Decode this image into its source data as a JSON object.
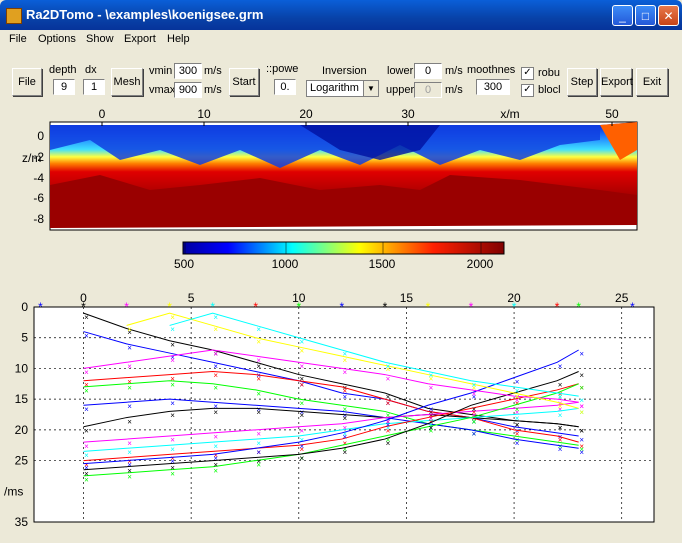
{
  "window": {
    "title": "Ra2DTomo - \\examples\\koenigsee.grm"
  },
  "menu": [
    "File",
    "Options",
    "Show",
    "Export",
    "Help"
  ],
  "toolbar": {
    "file_btn": "File",
    "depth_label": "depth",
    "depth_value": "9",
    "dx_label": "dx",
    "dx_value": "1",
    "mesh_btn": "Mesh",
    "vmin_label": "vmin",
    "vmin_value": "300",
    "vmin_unit": "m/s",
    "vmax_label": "vmax",
    "vmax_value": "900",
    "vmax_unit": "m/s",
    "start_btn": "Start",
    "power_label": "::powe",
    "power_value": "0.",
    "inversion_label": "Inversion",
    "inversion_value": "Logarithm",
    "lower_label": "lower",
    "lower_value": "0",
    "lower_unit": "m/s",
    "upper_label": "upper",
    "upper_value": "0",
    "upper_unit": "m/s",
    "smoothness_label": "moothnes",
    "smoothness_value": "300",
    "robust_label": "robu",
    "robust_checked": true,
    "block_label": "blocl",
    "block_checked": true,
    "step_btn": "Step",
    "export_btn": "Export",
    "exit_btn": "Exit"
  },
  "model_plot": {
    "x_ticks": [
      "0",
      "10",
      "20",
      "30",
      "50"
    ],
    "x_label": "x/m",
    "y_ticks": [
      "0",
      "-2",
      "-4",
      "-6",
      "-8"
    ],
    "y_label": "z/m",
    "colorbar_ticks": [
      "500",
      "1000",
      "1500",
      "2000"
    ]
  },
  "chart_data": {
    "type": "scatter",
    "x_ticks": [
      "0",
      "5",
      "10",
      "15",
      "20",
      "25"
    ],
    "y_ticks": [
      "0",
      "5",
      "10",
      "15",
      "20",
      "25",
      "35"
    ],
    "y_label": "/ms",
    "xlim": [
      -2.3,
      26.5
    ],
    "ylim": [
      0,
      35
    ],
    "grid": true,
    "shots": [
      {
        "x": -2,
        "color": "#0000ff"
      },
      {
        "x": 0,
        "color": "#000000"
      },
      {
        "x": 2,
        "color": "#ff00ff"
      },
      {
        "x": 4,
        "color": "#ffff00"
      },
      {
        "x": 6,
        "color": "#00ffff"
      },
      {
        "x": 8,
        "color": "#ff0000"
      },
      {
        "x": 10,
        "color": "#00ff00"
      },
      {
        "x": 12,
        "color": "#0000ff"
      },
      {
        "x": 14,
        "color": "#000000"
      },
      {
        "x": 16,
        "color": "#ffff00"
      },
      {
        "x": 18,
        "color": "#ff00ff"
      },
      {
        "x": 20,
        "color": "#00ffff"
      },
      {
        "x": 22,
        "color": "#ff0000"
      },
      {
        "x": 23,
        "color": "#00ff00"
      },
      {
        "x": 25.5,
        "color": "#0000ff"
      }
    ],
    "curves": [
      {
        "color": "#000000",
        "x": [
          0,
          2,
          4,
          6,
          8,
          10,
          12,
          14,
          16,
          18,
          20,
          22,
          23
        ],
        "y": [
          1,
          3.5,
          5.5,
          7,
          9,
          11,
          12.5,
          14,
          16.5,
          17.5,
          18.5,
          19,
          19.5
        ]
      },
      {
        "color": "#0000ff",
        "x": [
          0,
          2,
          4,
          6,
          8,
          10,
          12,
          14,
          16,
          18,
          20,
          22,
          23
        ],
        "y": [
          4,
          6,
          7.5,
          9,
          10.5,
          12,
          14,
          15,
          17,
          18,
          19.5,
          20.5,
          21
        ]
      },
      {
        "color": "#ff0000",
        "x": [
          0,
          2,
          4,
          6,
          8,
          10,
          12,
          14,
          16,
          18,
          20,
          22,
          23
        ],
        "y": [
          12,
          11.5,
          11,
          10.5,
          11,
          12,
          13,
          15,
          17,
          18,
          20,
          21,
          22
        ]
      },
      {
        "color": "#00ff00",
        "x": [
          0,
          2,
          4,
          6,
          8,
          10,
          12,
          14,
          16,
          18,
          20,
          22,
          23
        ],
        "y": [
          13,
          12.5,
          12,
          12.5,
          13.5,
          15,
          16,
          17,
          19,
          20,
          21,
          22,
          22.5
        ]
      },
      {
        "color": "#0000ff",
        "x": [
          0,
          2,
          4,
          6,
          8,
          10,
          12,
          14,
          16,
          18,
          20,
          22,
          23
        ],
        "y": [
          16,
          15.5,
          15,
          15.5,
          16,
          16.5,
          17,
          18,
          19,
          20,
          21.5,
          22.5,
          23
        ]
      },
      {
        "color": "#000000",
        "x": [
          0,
          2,
          4,
          6,
          8,
          10,
          12,
          14,
          16,
          18,
          20,
          22,
          23
        ],
        "y": [
          19.5,
          18,
          17,
          16.5,
          16.5,
          17,
          17.5,
          18,
          17.5,
          18,
          18.5,
          19,
          19.5
        ]
      },
      {
        "color": "#ff00ff",
        "x": [
          0,
          2,
          4,
          6,
          8,
          10,
          12,
          14,
          16,
          18,
          20,
          22,
          23
        ],
        "y": [
          22,
          21.5,
          21,
          20.5,
          20,
          19.5,
          19,
          18,
          17.5,
          17,
          16.5,
          16,
          15.5
        ]
      },
      {
        "color": "#00ffff",
        "x": [
          0,
          2,
          4,
          6,
          8,
          10,
          12,
          14,
          16,
          18,
          20,
          22,
          23
        ],
        "y": [
          23.5,
          23,
          22.5,
          22,
          21.5,
          21,
          20,
          19,
          18.5,
          18,
          17.5,
          17,
          16.5
        ]
      },
      {
        "color": "#ff0000",
        "x": [
          0,
          2,
          4,
          6,
          8,
          10,
          12,
          14,
          16,
          18,
          20,
          22,
          23
        ],
        "y": [
          25,
          24.5,
          24,
          23.5,
          23,
          22.5,
          21.5,
          19.5,
          18,
          16.5,
          15,
          13.5,
          12.5
        ]
      },
      {
        "color": "#0000ff",
        "x": [
          0,
          2,
          4,
          6,
          8,
          10,
          12,
          14,
          16,
          18,
          20,
          22,
          23
        ],
        "y": [
          25.5,
          25,
          24.5,
          24,
          23,
          22,
          20.5,
          18.5,
          16,
          14,
          11.5,
          9,
          7
        ]
      },
      {
        "color": "#00ff00",
        "x": [
          0,
          2,
          4,
          6,
          8,
          10,
          12,
          14,
          16,
          18,
          20,
          22,
          23
        ],
        "y": [
          27.5,
          27,
          26.5,
          26,
          25,
          24,
          22.5,
          21,
          19.5,
          18,
          16,
          14,
          12.5
        ]
      },
      {
        "color": "#000000",
        "x": [
          0,
          2,
          4,
          6,
          8,
          10,
          12,
          14,
          16,
          18,
          20,
          22,
          23
        ],
        "y": [
          26.5,
          26,
          25.5,
          25,
          24.5,
          24,
          23,
          21.5,
          19,
          16,
          14,
          12,
          10.5
        ]
      },
      {
        "color": "#ff00ff",
        "x": [
          0,
          2,
          4,
          6,
          8,
          10,
          12,
          14,
          16,
          18,
          20,
          22,
          23
        ],
        "y": [
          10,
          9,
          8,
          7,
          8,
          9,
          10,
          11,
          12.5,
          13.5,
          14.5,
          15,
          15.5
        ]
      },
      {
        "color": "#ffff00",
        "x": [
          2,
          4,
          6,
          8,
          10,
          12,
          14,
          16,
          18,
          20,
          22,
          23
        ],
        "y": [
          3,
          1,
          3,
          5,
          6.5,
          8,
          9.5,
          11,
          12.5,
          14,
          15.5,
          16.5
        ]
      },
      {
        "color": "#00ffff",
        "x": [
          4,
          6,
          8,
          10,
          12,
          14,
          16,
          18,
          20,
          22,
          23
        ],
        "y": [
          3,
          1,
          3,
          5,
          7,
          9,
          10.5,
          12,
          13,
          14,
          14.5
        ]
      }
    ]
  }
}
